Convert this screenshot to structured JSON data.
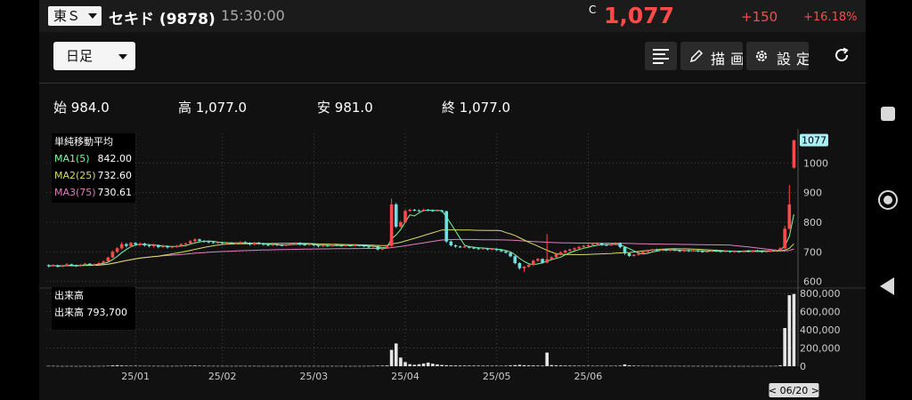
{
  "header": {
    "market": "東Ｓ",
    "stock_name": "セキド (9878)",
    "time": "15:30:00",
    "price_flag": "C",
    "price": "1,077",
    "change": "+150",
    "change_pct": "+16.18%"
  },
  "toolbar": {
    "period": "日足",
    "draw_label": "描画",
    "settings_label": "設定"
  },
  "ohlc": {
    "open_label": "始",
    "open": "984.0",
    "high_label": "高",
    "high": "1,077.0",
    "low_label": "安",
    "low": "981.0",
    "close_label": "終",
    "close": "1,077.0"
  },
  "ma_legend": {
    "title": "単純移動平均",
    "items": [
      {
        "label": "MA1(5)",
        "value": "842.00",
        "color": "#7cfc9c"
      },
      {
        "label": "MA2(25)",
        "value": "732.60",
        "color": "#d9d96a"
      },
      {
        "label": "MA3(75)",
        "value": "730.61",
        "color": "#e07fc6"
      }
    ]
  },
  "volume_legend": {
    "title": "出来高",
    "label": "出来高",
    "value": "793,700"
  },
  "colors": {
    "up": "#ff4a4a",
    "down": "#6fe0e0",
    "price_tag_bg": "#a8f0f5"
  },
  "chart_data": {
    "type": "candlestick",
    "price_axis": {
      "ticks": [
        "600",
        "700",
        "800",
        "900",
        "1000"
      ],
      "range": [
        590,
        1100
      ]
    },
    "price_tag": "1077",
    "volume_axis": {
      "ticks": [
        "0",
        "200,000",
        "400,000",
        "600,000",
        "800,000"
      ],
      "range": [
        0,
        830000
      ]
    },
    "x_labels": [
      "25/01",
      "25/02",
      "25/03",
      "25/04",
      "25/05",
      "25/06"
    ],
    "date_tag": "< 06/20 >",
    "candles": [
      {
        "o": 655,
        "c": 652,
        "h": 658,
        "l": 648
      },
      {
        "o": 652,
        "c": 655,
        "h": 658,
        "l": 650
      },
      {
        "o": 655,
        "c": 650,
        "h": 657,
        "l": 647
      },
      {
        "o": 650,
        "c": 653,
        "h": 656,
        "l": 648
      },
      {
        "o": 653,
        "c": 658,
        "h": 662,
        "l": 651
      },
      {
        "o": 658,
        "c": 654,
        "h": 660,
        "l": 651
      },
      {
        "o": 654,
        "c": 652,
        "h": 657,
        "l": 649
      },
      {
        "o": 652,
        "c": 656,
        "h": 659,
        "l": 650
      },
      {
        "o": 656,
        "c": 660,
        "h": 663,
        "l": 654
      },
      {
        "o": 660,
        "c": 656,
        "h": 662,
        "l": 653
      },
      {
        "o": 656,
        "c": 658,
        "h": 661,
        "l": 653
      },
      {
        "o": 658,
        "c": 662,
        "h": 666,
        "l": 656
      },
      {
        "o": 662,
        "c": 668,
        "h": 672,
        "l": 660
      },
      {
        "o": 668,
        "c": 681,
        "h": 684,
        "l": 666
      },
      {
        "o": 681,
        "c": 700,
        "h": 705,
        "l": 679
      },
      {
        "o": 700,
        "c": 712,
        "h": 716,
        "l": 696
      },
      {
        "o": 712,
        "c": 726,
        "h": 733,
        "l": 708
      },
      {
        "o": 726,
        "c": 720,
        "h": 730,
        "l": 715
      },
      {
        "o": 720,
        "c": 730,
        "h": 734,
        "l": 716
      },
      {
        "o": 730,
        "c": 725,
        "h": 733,
        "l": 720
      },
      {
        "o": 725,
        "c": 728,
        "h": 732,
        "l": 720
      },
      {
        "o": 728,
        "c": 722,
        "h": 731,
        "l": 718
      },
      {
        "o": 722,
        "c": 719,
        "h": 726,
        "l": 715
      },
      {
        "o": 719,
        "c": 723,
        "h": 727,
        "l": 714
      },
      {
        "o": 723,
        "c": 716,
        "h": 725,
        "l": 712
      },
      {
        "o": 716,
        "c": 720,
        "h": 724,
        "l": 713
      },
      {
        "o": 720,
        "c": 715,
        "h": 722,
        "l": 711
      },
      {
        "o": 715,
        "c": 718,
        "h": 721,
        "l": 712
      },
      {
        "o": 718,
        "c": 720,
        "h": 724,
        "l": 714
      },
      {
        "o": 720,
        "c": 726,
        "h": 729,
        "l": 717
      },
      {
        "o": 726,
        "c": 728,
        "h": 732,
        "l": 722
      },
      {
        "o": 728,
        "c": 736,
        "h": 740,
        "l": 725
      },
      {
        "o": 736,
        "c": 742,
        "h": 746,
        "l": 731
      },
      {
        "o": 742,
        "c": 737,
        "h": 745,
        "l": 733
      },
      {
        "o": 737,
        "c": 735,
        "h": 740,
        "l": 731
      },
      {
        "o": 735,
        "c": 733,
        "h": 738,
        "l": 729
      },
      {
        "o": 733,
        "c": 730,
        "h": 736,
        "l": 727
      },
      {
        "o": 730,
        "c": 732,
        "h": 735,
        "l": 727
      },
      {
        "o": 732,
        "c": 729,
        "h": 734,
        "l": 725
      },
      {
        "o": 729,
        "c": 731,
        "h": 734,
        "l": 726
      },
      {
        "o": 731,
        "c": 728,
        "h": 733,
        "l": 725
      },
      {
        "o": 728,
        "c": 730,
        "h": 733,
        "l": 725
      },
      {
        "o": 730,
        "c": 733,
        "h": 736,
        "l": 727
      },
      {
        "o": 733,
        "c": 730,
        "h": 736,
        "l": 727
      },
      {
        "o": 730,
        "c": 725,
        "h": 733,
        "l": 721
      },
      {
        "o": 725,
        "c": 731,
        "h": 734,
        "l": 722
      },
      {
        "o": 731,
        "c": 728,
        "h": 734,
        "l": 724
      },
      {
        "o": 728,
        "c": 724,
        "h": 731,
        "l": 721
      },
      {
        "o": 724,
        "c": 722,
        "h": 727,
        "l": 719
      },
      {
        "o": 722,
        "c": 725,
        "h": 728,
        "l": 719
      },
      {
        "o": 725,
        "c": 723,
        "h": 728,
        "l": 720
      },
      {
        "o": 723,
        "c": 722,
        "h": 726,
        "l": 719
      },
      {
        "o": 722,
        "c": 724,
        "h": 727,
        "l": 719
      },
      {
        "o": 724,
        "c": 728,
        "h": 731,
        "l": 721
      },
      {
        "o": 728,
        "c": 730,
        "h": 733,
        "l": 725
      },
      {
        "o": 730,
        "c": 725,
        "h": 733,
        "l": 721
      },
      {
        "o": 725,
        "c": 723,
        "h": 728,
        "l": 720
      },
      {
        "o": 723,
        "c": 726,
        "h": 729,
        "l": 720
      },
      {
        "o": 726,
        "c": 722,
        "h": 728,
        "l": 718
      },
      {
        "o": 722,
        "c": 719,
        "h": 724,
        "l": 715
      },
      {
        "o": 719,
        "c": 722,
        "h": 725,
        "l": 716
      },
      {
        "o": 722,
        "c": 720,
        "h": 724,
        "l": 717
      },
      {
        "o": 720,
        "c": 724,
        "h": 727,
        "l": 717
      },
      {
        "o": 724,
        "c": 722,
        "h": 726,
        "l": 719
      },
      {
        "o": 722,
        "c": 720,
        "h": 725,
        "l": 717
      },
      {
        "o": 720,
        "c": 722,
        "h": 725,
        "l": 718
      },
      {
        "o": 722,
        "c": 721,
        "h": 724,
        "l": 718
      },
      {
        "o": 721,
        "c": 723,
        "h": 726,
        "l": 718
      },
      {
        "o": 723,
        "c": 721,
        "h": 725,
        "l": 718
      },
      {
        "o": 721,
        "c": 718,
        "h": 724,
        "l": 715
      },
      {
        "o": 718,
        "c": 716,
        "h": 721,
        "l": 712
      },
      {
        "o": 716,
        "c": 719,
        "h": 722,
        "l": 713
      },
      {
        "o": 719,
        "c": 708,
        "h": 721,
        "l": 705
      },
      {
        "o": 708,
        "c": 712,
        "h": 716,
        "l": 706
      },
      {
        "o": 712,
        "c": 720,
        "h": 724,
        "l": 710
      },
      {
        "o": 720,
        "c": 860,
        "h": 880,
        "l": 718
      },
      {
        "o": 860,
        "c": 785,
        "h": 865,
        "l": 780
      },
      {
        "o": 785,
        "c": 800,
        "h": 805,
        "l": 782
      },
      {
        "o": 800,
        "c": 838,
        "h": 843,
        "l": 798
      },
      {
        "o": 838,
        "c": 842,
        "h": 846,
        "l": 835
      },
      {
        "o": 842,
        "c": 840,
        "h": 845,
        "l": 837
      },
      {
        "o": 840,
        "c": 838,
        "h": 843,
        "l": 835
      },
      {
        "o": 838,
        "c": 842,
        "h": 846,
        "l": 836
      },
      {
        "o": 842,
        "c": 840,
        "h": 845,
        "l": 837
      },
      {
        "o": 840,
        "c": 838,
        "h": 843,
        "l": 835
      },
      {
        "o": 838,
        "c": 840,
        "h": 843,
        "l": 836
      },
      {
        "o": 840,
        "c": 837,
        "h": 842,
        "l": 833
      },
      {
        "o": 837,
        "c": 735,
        "h": 839,
        "l": 730
      },
      {
        "o": 735,
        "c": 722,
        "h": 738,
        "l": 718
      },
      {
        "o": 722,
        "c": 718,
        "h": 725,
        "l": 714
      },
      {
        "o": 718,
        "c": 716,
        "h": 721,
        "l": 713
      },
      {
        "o": 716,
        "c": 718,
        "h": 721,
        "l": 713
      },
      {
        "o": 718,
        "c": 714,
        "h": 720,
        "l": 711
      },
      {
        "o": 714,
        "c": 712,
        "h": 717,
        "l": 709
      },
      {
        "o": 712,
        "c": 710,
        "h": 715,
        "l": 707
      },
      {
        "o": 710,
        "c": 712,
        "h": 714,
        "l": 707
      },
      {
        "o": 712,
        "c": 708,
        "h": 714,
        "l": 705
      },
      {
        "o": 708,
        "c": 710,
        "h": 713,
        "l": 706
      },
      {
        "o": 710,
        "c": 706,
        "h": 712,
        "l": 703
      },
      {
        "o": 706,
        "c": 702,
        "h": 709,
        "l": 699
      },
      {
        "o": 702,
        "c": 697,
        "h": 705,
        "l": 694
      },
      {
        "o": 697,
        "c": 685,
        "h": 699,
        "l": 682
      },
      {
        "o": 685,
        "c": 662,
        "h": 688,
        "l": 658
      },
      {
        "o": 662,
        "c": 645,
        "h": 665,
        "l": 640
      },
      {
        "o": 645,
        "c": 650,
        "h": 652,
        "l": 632
      },
      {
        "o": 650,
        "c": 656,
        "h": 659,
        "l": 646
      },
      {
        "o": 656,
        "c": 670,
        "h": 674,
        "l": 653
      },
      {
        "o": 670,
        "c": 676,
        "h": 679,
        "l": 666
      },
      {
        "o": 676,
        "c": 664,
        "h": 678,
        "l": 660
      },
      {
        "o": 664,
        "c": 675,
        "h": 760,
        "l": 661
      },
      {
        "o": 675,
        "c": 682,
        "h": 685,
        "l": 671
      },
      {
        "o": 682,
        "c": 692,
        "h": 695,
        "l": 679
      },
      {
        "o": 692,
        "c": 698,
        "h": 702,
        "l": 688
      },
      {
        "o": 698,
        "c": 704,
        "h": 708,
        "l": 695
      },
      {
        "o": 704,
        "c": 708,
        "h": 711,
        "l": 701
      },
      {
        "o": 708,
        "c": 712,
        "h": 715,
        "l": 704
      },
      {
        "o": 712,
        "c": 716,
        "h": 720,
        "l": 708
      },
      {
        "o": 716,
        "c": 720,
        "h": 724,
        "l": 712
      },
      {
        "o": 720,
        "c": 722,
        "h": 726,
        "l": 717
      },
      {
        "o": 722,
        "c": 726,
        "h": 729,
        "l": 719
      },
      {
        "o": 726,
        "c": 728,
        "h": 732,
        "l": 722
      },
      {
        "o": 728,
        "c": 724,
        "h": 731,
        "l": 720
      },
      {
        "o": 724,
        "c": 722,
        "h": 727,
        "l": 719
      },
      {
        "o": 722,
        "c": 726,
        "h": 729,
        "l": 719
      },
      {
        "o": 726,
        "c": 730,
        "h": 733,
        "l": 722
      },
      {
        "o": 730,
        "c": 716,
        "h": 732,
        "l": 712
      },
      {
        "o": 716,
        "c": 695,
        "h": 718,
        "l": 690
      },
      {
        "o": 695,
        "c": 686,
        "h": 698,
        "l": 683
      },
      {
        "o": 686,
        "c": 690,
        "h": 693,
        "l": 684
      },
      {
        "o": 690,
        "c": 694,
        "h": 697,
        "l": 687
      },
      {
        "o": 694,
        "c": 700,
        "h": 703,
        "l": 690
      },
      {
        "o": 700,
        "c": 705,
        "h": 708,
        "l": 697
      },
      {
        "o": 705,
        "c": 708,
        "h": 711,
        "l": 702
      },
      {
        "o": 708,
        "c": 706,
        "h": 711,
        "l": 703
      },
      {
        "o": 706,
        "c": 708,
        "h": 711,
        "l": 703
      },
      {
        "o": 708,
        "c": 705,
        "h": 710,
        "l": 702
      },
      {
        "o": 705,
        "c": 707,
        "h": 710,
        "l": 702
      },
      {
        "o": 707,
        "c": 705,
        "h": 709,
        "l": 702
      },
      {
        "o": 705,
        "c": 702,
        "h": 708,
        "l": 699
      },
      {
        "o": 702,
        "c": 705,
        "h": 708,
        "l": 699
      },
      {
        "o": 705,
        "c": 703,
        "h": 708,
        "l": 700
      },
      {
        "o": 703,
        "c": 705,
        "h": 708,
        "l": 700
      },
      {
        "o": 705,
        "c": 702,
        "h": 707,
        "l": 699
      },
      {
        "o": 702,
        "c": 700,
        "h": 705,
        "l": 697
      },
      {
        "o": 700,
        "c": 702,
        "h": 705,
        "l": 697
      },
      {
        "o": 702,
        "c": 705,
        "h": 708,
        "l": 699
      },
      {
        "o": 705,
        "c": 703,
        "h": 708,
        "l": 700
      },
      {
        "o": 703,
        "c": 701,
        "h": 706,
        "l": 698
      },
      {
        "o": 701,
        "c": 703,
        "h": 706,
        "l": 698
      },
      {
        "o": 703,
        "c": 700,
        "h": 705,
        "l": 697
      },
      {
        "o": 700,
        "c": 702,
        "h": 705,
        "l": 697
      },
      {
        "o": 702,
        "c": 700,
        "h": 704,
        "l": 697
      },
      {
        "o": 700,
        "c": 703,
        "h": 706,
        "l": 697
      },
      {
        "o": 703,
        "c": 701,
        "h": 706,
        "l": 698
      },
      {
        "o": 701,
        "c": 704,
        "h": 707,
        "l": 698
      },
      {
        "o": 704,
        "c": 702,
        "h": 707,
        "l": 699
      },
      {
        "o": 702,
        "c": 700,
        "h": 705,
        "l": 697
      },
      {
        "o": 700,
        "c": 702,
        "h": 705,
        "l": 697
      },
      {
        "o": 702,
        "c": 704,
        "h": 707,
        "l": 699
      },
      {
        "o": 704,
        "c": 706,
        "h": 709,
        "l": 701
      },
      {
        "o": 706,
        "c": 712,
        "h": 715,
        "l": 703
      },
      {
        "o": 712,
        "c": 778,
        "h": 788,
        "l": 710
      },
      {
        "o": 778,
        "c": 860,
        "h": 925,
        "l": 775
      },
      {
        "o": 984,
        "c": 1077,
        "h": 1077,
        "l": 981
      }
    ],
    "volume": [
      4000,
      3500,
      3000,
      2500,
      2800,
      3000,
      2600,
      2400,
      3200,
      2800,
      2600,
      3000,
      3500,
      5200,
      9000,
      11000,
      8000,
      6000,
      5200,
      4800,
      4500,
      4200,
      4000,
      3800,
      3600,
      3500,
      3200,
      3000,
      3600,
      4200,
      4500,
      5500,
      6500,
      5000,
      4200,
      3800,
      3500,
      3300,
      3000,
      3200,
      3000,
      3200,
      3500,
      3300,
      3500,
      3300,
      3100,
      3000,
      2800,
      3000,
      2800,
      2700,
      2900,
      3200,
      3500,
      3300,
      3000,
      2900,
      3100,
      3000,
      2900,
      3000,
      3200,
      3000,
      2800,
      2900,
      2700,
      2800,
      2900,
      3000,
      3500,
      4200,
      5500,
      6500,
      8000,
      180000,
      250000,
      95000,
      45000,
      22000,
      16000,
      22000,
      30000,
      40000,
      28000,
      20000,
      14000,
      11000,
      9000,
      8000,
      7500,
      7000,
      6800,
      6500,
      6200,
      6000,
      5800,
      5500,
      5200,
      5000,
      6000,
      9000,
      12000,
      15000,
      11000,
      9000,
      8000,
      7000,
      6500,
      150000,
      12000,
      9000,
      8000,
      7000,
      6500,
      6000,
      5500,
      5200,
      5000,
      4800,
      4600,
      4500,
      4400,
      4500,
      4800,
      6000,
      20000,
      9000,
      6000,
      5000,
      4500,
      4300,
      4100,
      4000,
      3900,
      3800,
      3600,
      3500,
      3400,
      3300,
      3200,
      3100,
      3000,
      3000,
      2900,
      2800,
      2800,
      2700,
      2700,
      2600,
      2600,
      2500,
      2500,
      2500,
      2600,
      2700,
      2800,
      2900,
      3000,
      3500,
      9000,
      420000,
      780000,
      793700
    ]
  }
}
